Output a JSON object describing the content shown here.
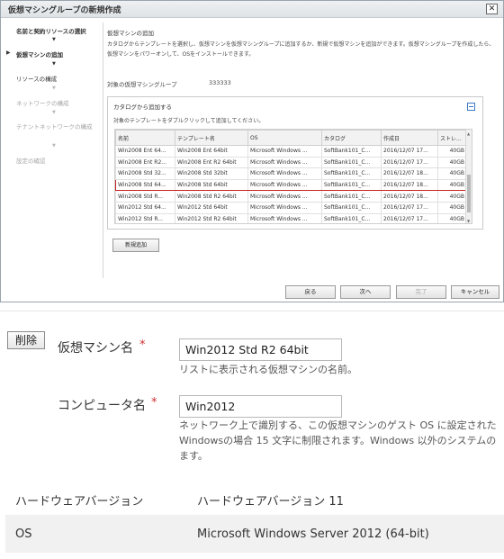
{
  "dialog": {
    "title": "仮想マシングループの新規作成",
    "close_symbol": "✕"
  },
  "wizard_steps": [
    {
      "label": "名前と契約リソースの選択",
      "state": "done",
      "marker": ""
    },
    {
      "label": "仮想マシンの追加",
      "state": "active",
      "marker": "▶"
    },
    {
      "label": "リソースの構成",
      "state": "done",
      "marker": ""
    },
    {
      "label": "ネットワークの構成",
      "state": "pending",
      "marker": ""
    },
    {
      "label": "テナントネットワークの構成",
      "state": "pending",
      "marker": ""
    },
    {
      "label": "設定の確認",
      "state": "pending",
      "marker": ""
    }
  ],
  "arrow_symbol": "▼",
  "content": {
    "section_title": "仮想マシンの追加",
    "description": "カタログからテンプレートを選択し、仮想マシンを仮想マシングループに追加するか、新規で仮想マシンを追加ができます。仮想マシングループを作成したら、仮想マシンをパワーオンして、OSをインストールできます。",
    "group_label": "対象の仮想マシングループ",
    "group_value": "333333"
  },
  "catalog": {
    "title": "カタログから追加する",
    "hint": "対象のテンプレートをダブルクリックして追加してください。",
    "columns": [
      "名前",
      "テンプレート名",
      "OS",
      "カタログ",
      "作成日",
      "ストレ..."
    ],
    "rows": [
      [
        "Win2008 Ent 64...",
        "Win2008 Ent 64bit",
        "Microsoft Windows ...",
        "SoftBank101_C...",
        "2016/12/07 17...",
        "40GB"
      ],
      [
        "Win2008 Ent R2...",
        "Win2008 Ent R2 64bit",
        "Microsoft Windows ...",
        "SoftBank101_C...",
        "2016/12/07 17...",
        "40GB"
      ],
      [
        "Win2008 Std 32...",
        "Win2008 Std 32bit",
        "Microsoft Windows ...",
        "SoftBank101_C...",
        "2016/12/07 18...",
        "40GB"
      ],
      [
        "Win2008 Std 64...",
        "Win2008 Std 64bit",
        "Microsoft Windows ...",
        "SoftBank101_C...",
        "2016/12/07 18...",
        "40GB"
      ],
      [
        "Win2008 Std R...",
        "Win2008 Std R2 64bit",
        "Microsoft Windows ...",
        "SoftBank101_C...",
        "2016/12/07 18...",
        "40GB"
      ],
      [
        "Win2012 Std 64...",
        "Win2012 Std 64bit",
        "Microsoft Windows ...",
        "SoftBank101_C...",
        "2016/12/07 17...",
        "40GB"
      ],
      [
        "Win2012 Std R...",
        "Win2012 Std R2 64bit",
        "Microsoft Windows ...",
        "SoftBank101_C...",
        "2016/12/07 17...",
        "40GB"
      ]
    ],
    "selected_row_index": 3,
    "new_add_label": "新規追加"
  },
  "footer": {
    "back": "戻る",
    "next": "次へ",
    "finish": "完了",
    "cancel": "キャンセル"
  },
  "vm_panel": {
    "delete_label": "削除",
    "vm_name_label": "仮想マシン名",
    "required_mark": "*",
    "vm_name_value": "Win2012 Std R2 64bit",
    "vm_name_help": "リストに表示される仮想マシンの名前。",
    "computer_name_label": "コンピュータ名",
    "computer_name_value": "Win2012",
    "computer_name_help_1": "ネットワーク上で識別する、この仮想マシンのゲスト OS に設定された",
    "computer_name_help_2": "Windowsの場合 15 文字に制限されます。Windows 以外のシステムの",
    "computer_name_help_3": "ます。",
    "hw_version_label": "ハードウェアバージョン",
    "hw_version_value": "ハードウェアバージョン 11",
    "os_label": "OS",
    "os_value": "Microsoft Windows Server 2012 (64-bit)"
  },
  "colors": {
    "selection_border": "#c92222",
    "required": "#d03030",
    "accent": "#3b78c4"
  }
}
